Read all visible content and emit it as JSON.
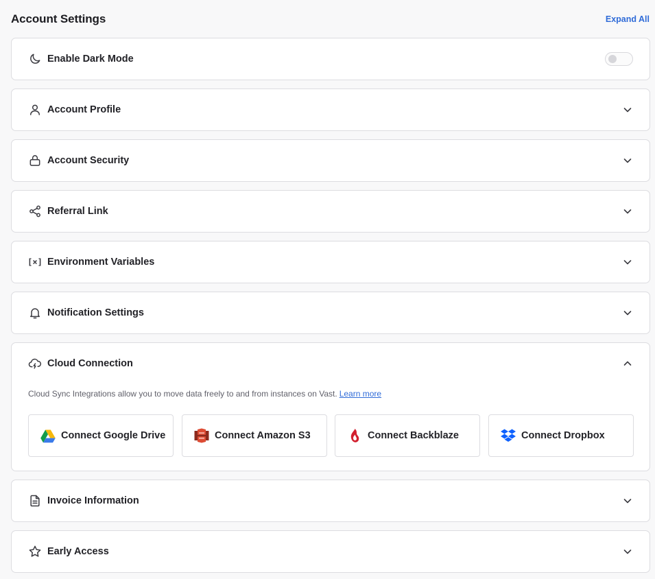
{
  "header": {
    "title": "Account Settings",
    "expand_all": "Expand All"
  },
  "sections": {
    "dark_mode": {
      "label": "Enable Dark Mode",
      "icon": "moon-icon",
      "enabled": false
    },
    "profile": {
      "label": "Account Profile",
      "icon": "user-icon"
    },
    "security": {
      "label": "Account Security",
      "icon": "lock-icon"
    },
    "referral": {
      "label": "Referral Link",
      "icon": "share-icon"
    },
    "env": {
      "label": "Environment Variables",
      "icon": "variable-icon",
      "icon_text": "[×]"
    },
    "notifications": {
      "label": "Notification Settings",
      "icon": "bell-icon"
    },
    "cloud": {
      "label": "Cloud Connection",
      "icon": "cloud-lightning-icon",
      "description": "Cloud Sync Integrations allow you to move data freely to and from instances on Vast.",
      "learn_more": "Learn more",
      "buttons": [
        {
          "label": "Connect Google Drive",
          "icon": "google-drive-icon"
        },
        {
          "label": "Connect Amazon S3",
          "icon": "amazon-s3-icon"
        },
        {
          "label": "Connect Backblaze",
          "icon": "backblaze-icon"
        },
        {
          "label": "Connect Dropbox",
          "icon": "dropbox-icon"
        }
      ]
    },
    "invoice": {
      "label": "Invoice Information",
      "icon": "document-icon"
    },
    "early_access": {
      "label": "Early Access",
      "icon": "star-icon"
    }
  },
  "colors": {
    "accent": "#2f6bd8",
    "card_border": "#dcdce0",
    "background": "#f8f8f9"
  }
}
